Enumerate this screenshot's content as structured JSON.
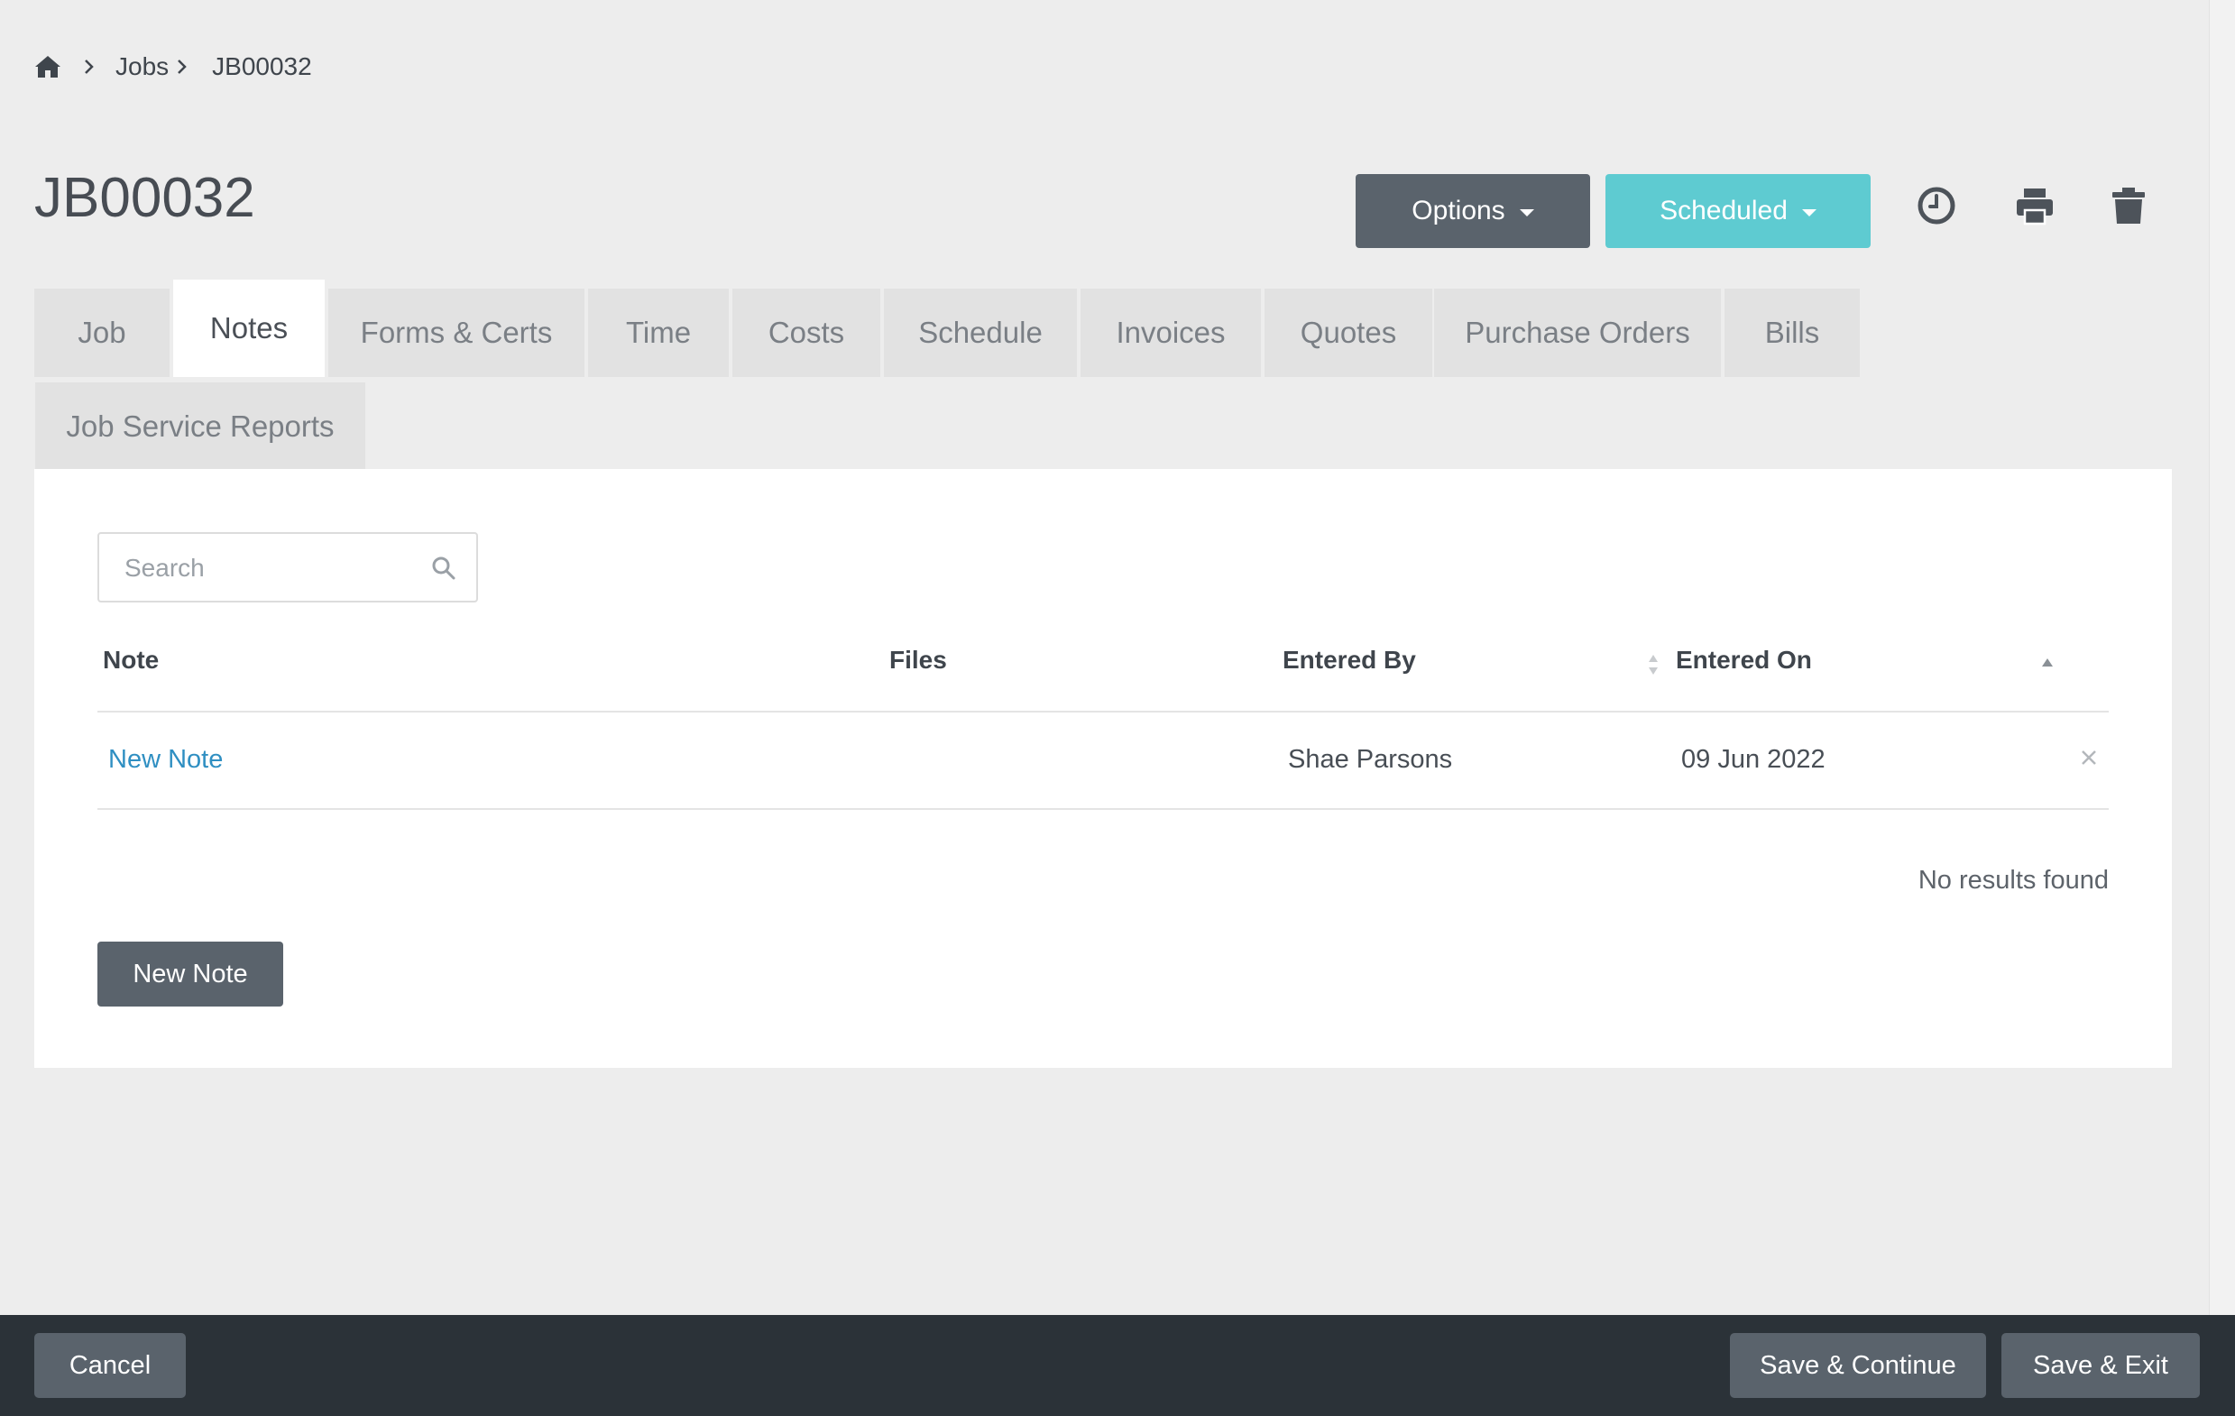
{
  "breadcrumb": {
    "jobs": "Jobs",
    "current": "JB00032"
  },
  "page": {
    "title": "JB00032"
  },
  "header": {
    "options_label": "Options",
    "status_label": "Scheduled",
    "status_color": "#5ecbd1"
  },
  "tabs": [
    {
      "label": "Job"
    },
    {
      "label": "Notes",
      "active": true
    },
    {
      "label": "Forms & Certs"
    },
    {
      "label": "Time"
    },
    {
      "label": "Costs"
    },
    {
      "label": "Schedule"
    },
    {
      "label": "Invoices"
    },
    {
      "label": "Quotes"
    },
    {
      "label": "Purchase Orders"
    },
    {
      "label": "Bills"
    },
    {
      "label": "Job Service Reports"
    }
  ],
  "search": {
    "placeholder": "Search"
  },
  "table": {
    "columns": [
      "Note",
      "Files",
      "Entered By",
      "Entered On"
    ],
    "rows": [
      {
        "note": "New Note",
        "files": "",
        "entered_by": "Shae Parsons",
        "entered_on": "09 Jun 2022"
      }
    ],
    "empty_text": "No results found"
  },
  "actions": {
    "new_note_label": "New Note"
  },
  "footer": {
    "cancel_label": "Cancel",
    "save_continue_label": "Save & Continue",
    "save_exit_label": "Save & Exit"
  },
  "icons": {
    "home": "home-icon",
    "history": "clock-icon",
    "print": "print-icon",
    "delete": "trash-icon",
    "search": "search-icon"
  }
}
